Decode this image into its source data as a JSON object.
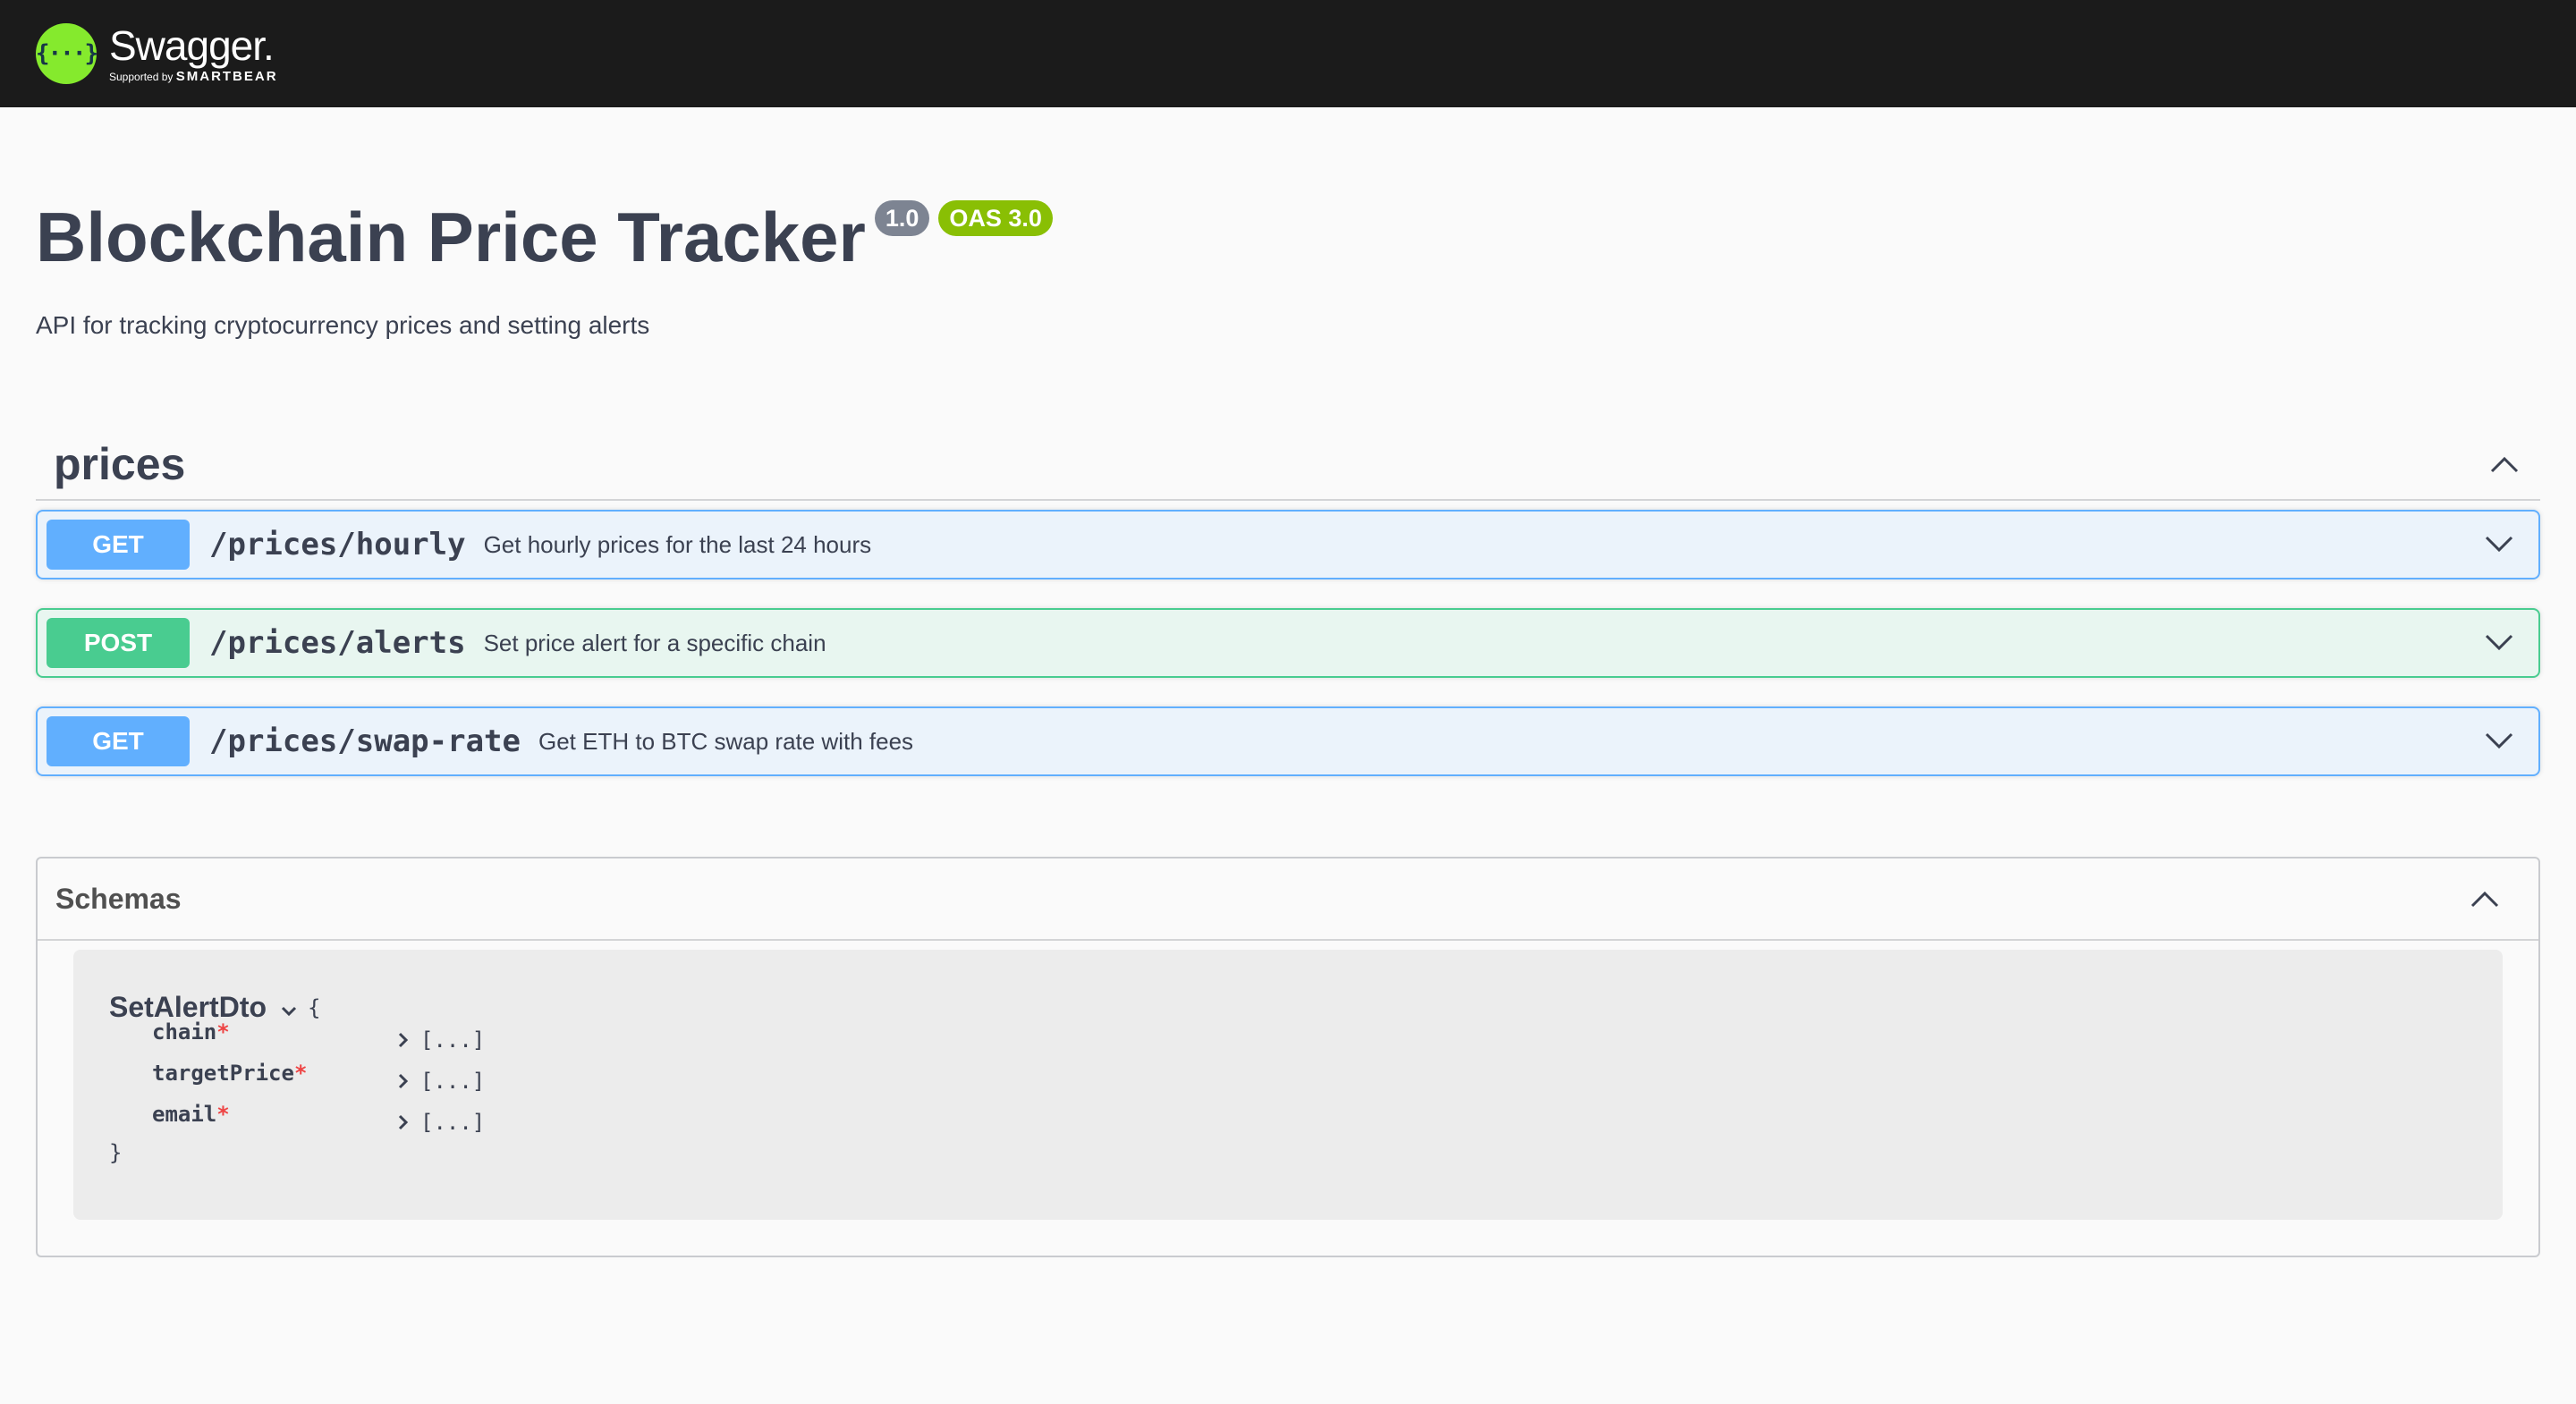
{
  "header": {
    "logo_glyph": "{···}",
    "brand": "Swagger.",
    "supported_by": "Supported by",
    "sponsor": "SMARTBEAR"
  },
  "info": {
    "title": "Blockchain Price Tracker",
    "version": "1.0",
    "oas": "OAS 3.0",
    "description": "API for tracking cryptocurrency prices and setting alerts"
  },
  "tag": {
    "name": "prices",
    "expanded": true,
    "operations": [
      {
        "method": "GET",
        "path": "/prices/hourly",
        "summary": "Get hourly prices for the last 24 hours"
      },
      {
        "method": "POST",
        "path": "/prices/alerts",
        "summary": "Set price alert for a specific chain"
      },
      {
        "method": "GET",
        "path": "/prices/swap-rate",
        "summary": "Get ETH to BTC swap rate with fees"
      }
    ]
  },
  "schemas": {
    "title": "Schemas",
    "model": {
      "name": "SetAlertDto",
      "open_brace": "{",
      "close_brace": "}",
      "properties": [
        {
          "name": "chain",
          "required_mark": "*",
          "type": "[...]"
        },
        {
          "name": "targetPrice",
          "required_mark": "*",
          "type": "[...]"
        },
        {
          "name": "email",
          "required_mark": "*",
          "type": "[...]"
        }
      ]
    }
  },
  "colors": {
    "get": "#61affe",
    "post": "#49cc90",
    "topbar": "#1b1b1b",
    "logo": "#85ea2d"
  }
}
